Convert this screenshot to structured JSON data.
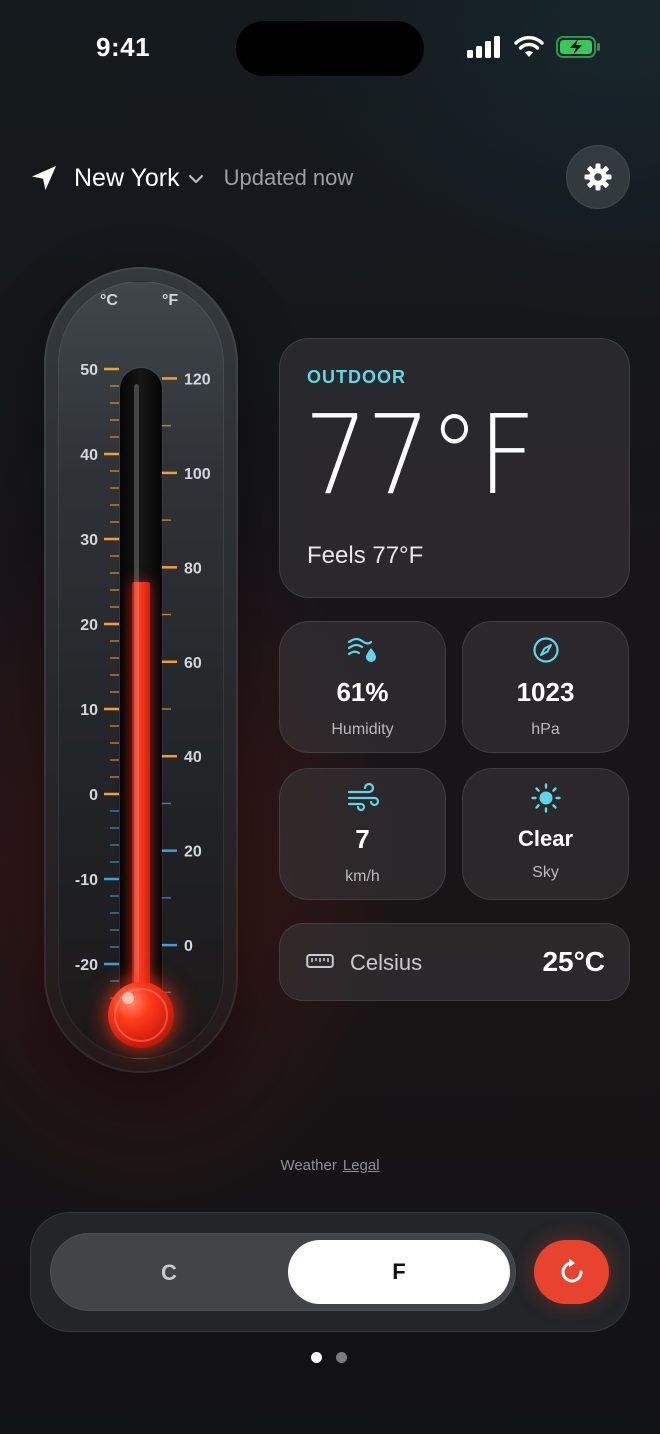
{
  "status": {
    "time": "9:41"
  },
  "header": {
    "city": "New York",
    "updated": "Updated now"
  },
  "thermometer": {
    "unit_c": "°C",
    "unit_f": "°F",
    "celsius_labels": [
      "50",
      "40",
      "30",
      "20",
      "10",
      "0",
      "-10",
      "-20"
    ],
    "fahrenheit_labels": [
      "120",
      "100",
      "80",
      "60",
      "40",
      "20",
      "0"
    ],
    "fill_celsius": 25
  },
  "outdoor": {
    "label": "OUTDOOR",
    "temp": "77°F",
    "feels": "Feels 77°F"
  },
  "tiles": [
    {
      "icon": "humidity-icon",
      "value": "61%",
      "label": "Humidity"
    },
    {
      "icon": "compass-icon",
      "value": "1023",
      "label": "hPa"
    },
    {
      "icon": "wind-icon",
      "value": "7",
      "label": "km/h"
    },
    {
      "icon": "sun-icon",
      "value": "Clear",
      "label": "Sky"
    }
  ],
  "celsius": {
    "label": "Celsius",
    "value": "25°C"
  },
  "footer": {
    "weather": "Weather",
    "legal": "Legal"
  },
  "toggle": {
    "c": "C",
    "f": "F",
    "selected": "F"
  },
  "colors": {
    "accent_cyan": "#5fd7e6",
    "mercury_red": "#ff3b1f",
    "refresh_red": "#e8432e",
    "scale_orange": "#f0a030",
    "scale_blue": "#3f9fdc"
  }
}
